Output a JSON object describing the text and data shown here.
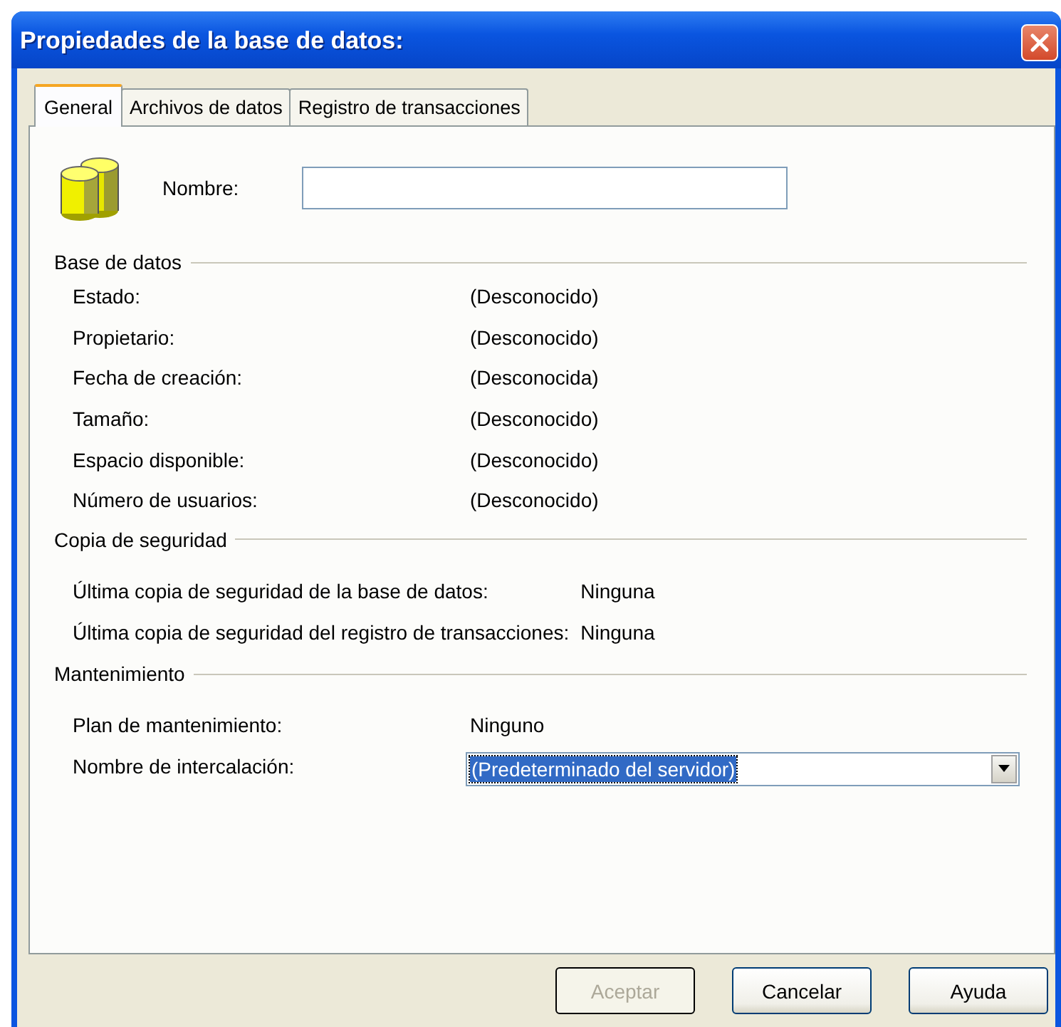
{
  "window": {
    "title": "Propiedades de la base de datos:"
  },
  "tabs": [
    {
      "label": "General",
      "selected": true
    },
    {
      "label": "Archivos de datos",
      "selected": false
    },
    {
      "label": "Registro de transacciones",
      "selected": false
    }
  ],
  "name_field": {
    "label": "Nombre:"
  },
  "sections": [
    {
      "heading": "Base de datos",
      "rows": [
        {
          "label": "Estado:",
          "value": "(Desconocido)"
        },
        {
          "label": "Propietario:",
          "value": "(Desconocido)"
        },
        {
          "label": "Fecha de creación:",
          "value": "(Desconocida)"
        },
        {
          "label": "Tamaño:",
          "value": "(Desconocido)"
        },
        {
          "label": "Espacio disponible:",
          "value": "(Desconocido)"
        },
        {
          "label": "Número de usuarios:",
          "value": "(Desconocido)"
        }
      ]
    },
    {
      "heading": "Copia de seguridad",
      "rows": [
        {
          "label": "Última copia de seguridad de la base de datos:",
          "value": "Ninguna"
        },
        {
          "label": "Última copia de seguridad del registro de transacciones:",
          "value": "Ninguna"
        }
      ]
    },
    {
      "heading": "Mantenimiento",
      "rows": [
        {
          "kind": "text",
          "label": "Plan de mantenimiento:",
          "value": "Ninguno"
        },
        {
          "kind": "combo",
          "label": "Nombre de intercalación:",
          "value": "(Predeterminado del servidor)",
          "text_selected": true
        }
      ]
    }
  ],
  "buttons": [
    {
      "label": "Aceptar",
      "disabled": true,
      "default": true
    },
    {
      "label": "Cancelar",
      "disabled": false,
      "default": false
    },
    {
      "label": "Ayuda",
      "disabled": false,
      "default": false
    }
  ]
}
